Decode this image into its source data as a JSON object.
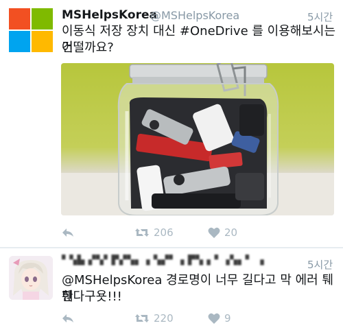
{
  "tweets": [
    {
      "display_name": "MSHelpsKorea",
      "handle": "@MSHelpsKorea",
      "time": "5시간",
      "text_line1": "이동식 저장 장치 대신 #OneDrive 를 이용해보시는 건",
      "text_line2": "어떨까요?",
      "retweets": "206",
      "likes": "20",
      "avatar_icon": "microsoft-logo",
      "logo_colors": [
        "#f25022",
        "#7fba00",
        "#00a4ef",
        "#ffb900"
      ]
    },
    {
      "display_name_blurred": "▘▚▙ ▞▚▘▛▞▚▖▗ ▚▞▘▗ ▛▚ ▖▘▗▚▖▘ ▗ ▘ ▝",
      "time": "5시간",
      "text_line1": "@MSHelpsKorea 경로명이 너무 길다고 막 에러 퉤퉤",
      "text_line2": "한다구욧!!!",
      "retweets": "220",
      "likes": "9",
      "avatar_icon": "anime-character-avatar"
    }
  ],
  "colors": {
    "text": "#14171a",
    "secondary": "#8899a6",
    "action": "#aab8c2",
    "divider": "#e6ecf0"
  }
}
